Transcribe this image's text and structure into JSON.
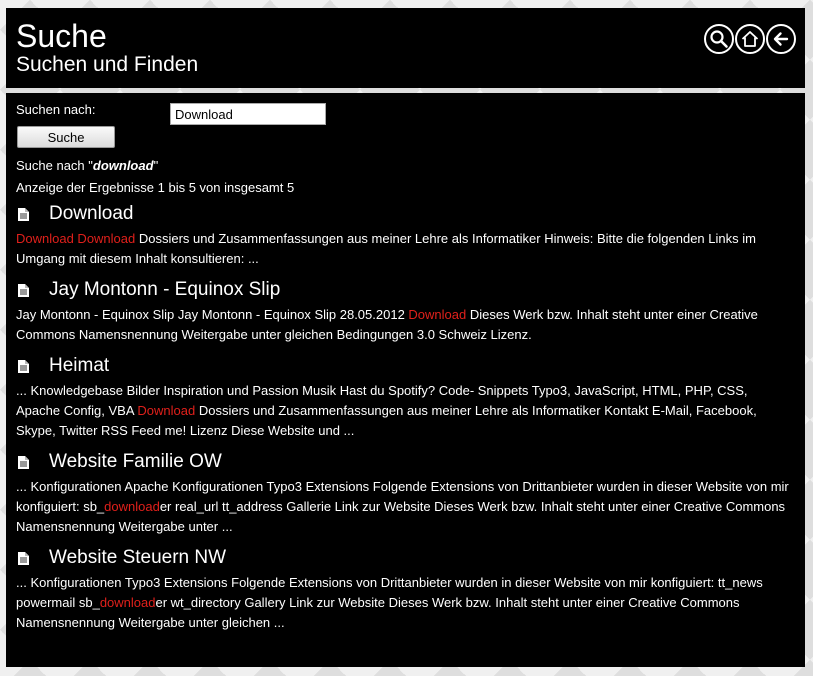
{
  "header": {
    "title": "Suche",
    "subtitle": "Suchen und Finden"
  },
  "search": {
    "label": "Suchen nach:",
    "value": "Download",
    "button_label": "Suche",
    "query_prefix": "Suche nach \"",
    "query_term": "download",
    "query_suffix": "\"",
    "results_info": "Anzeige der Ergebnisse 1 bis 5 von insgesamt 5"
  },
  "results": [
    {
      "title": "Download",
      "parts": [
        {
          "t": "Download Download",
          "hl": true
        },
        {
          "t": " Dossiers und Zusammenfassungen aus meiner Lehre als Informatiker Hinweis: Bitte die folgenden Links im Umgang mit diesem Inhalt konsultieren: ...",
          "hl": false
        }
      ]
    },
    {
      "title": "Jay Montonn - Equinox Slip",
      "parts": [
        {
          "t": "Jay Montonn - Equinox Slip Jay Montonn - Equinox Slip 28.05.2012 ",
          "hl": false
        },
        {
          "t": "Download",
          "hl": true
        },
        {
          "t": " Dieses Werk bzw. Inhalt steht unter einer Creative Commons Namensnennung Weitergabe unter gleichen Bedingungen 3.0 Schweiz Lizenz.",
          "hl": false
        }
      ]
    },
    {
      "title": "Heimat",
      "parts": [
        {
          "t": "... Knowledgebase Bilder Inspiration und Passion Musik Hast du Spotify? Code- Snippets Typo3, JavaScript, HTML, PHP, CSS, Apache Config, VBA ",
          "hl": false
        },
        {
          "t": "Download",
          "hl": true
        },
        {
          "t": " Dossiers und Zusammenfassungen aus meiner Lehre als Informatiker Kontakt E-Mail, Facebook, Skype, Twitter RSS Feed me! Lizenz Diese Website und ...",
          "hl": false
        }
      ]
    },
    {
      "title": "Website Familie OW",
      "parts": [
        {
          "t": "... Konfigurationen Apache Konfigurationen Typo3 Extensions Folgende Extensions von Drittanbieter wurden in dieser Website von mir konfiguiert: sb_",
          "hl": false
        },
        {
          "t": "download",
          "hl": true
        },
        {
          "t": "er real_url tt_address Gallerie Link zur Website Dieses Werk bzw. Inhalt steht unter einer Creative Commons Namensnennung Weitergabe unter ...",
          "hl": false
        }
      ]
    },
    {
      "title": "Website Steuern NW",
      "parts": [
        {
          "t": "... Konfigurationen Typo3 Extensions Folgende Extensions von Drittanbieter wurden in dieser Website von mir konfiguiert: tt_news powermail sb_",
          "hl": false
        },
        {
          "t": "download",
          "hl": true
        },
        {
          "t": "er wt_directory Gallery Link zur Website Dieses Werk bzw. Inhalt steht unter einer Creative Commons Namensnennung Weitergabe unter gleichen ...",
          "hl": false
        }
      ]
    }
  ],
  "colors": {
    "highlight": "#e0201b",
    "panel": "#000000"
  },
  "icons": {
    "nav": [
      "search-icon",
      "home-icon",
      "back-arrow-icon"
    ],
    "result": "document-icon"
  }
}
